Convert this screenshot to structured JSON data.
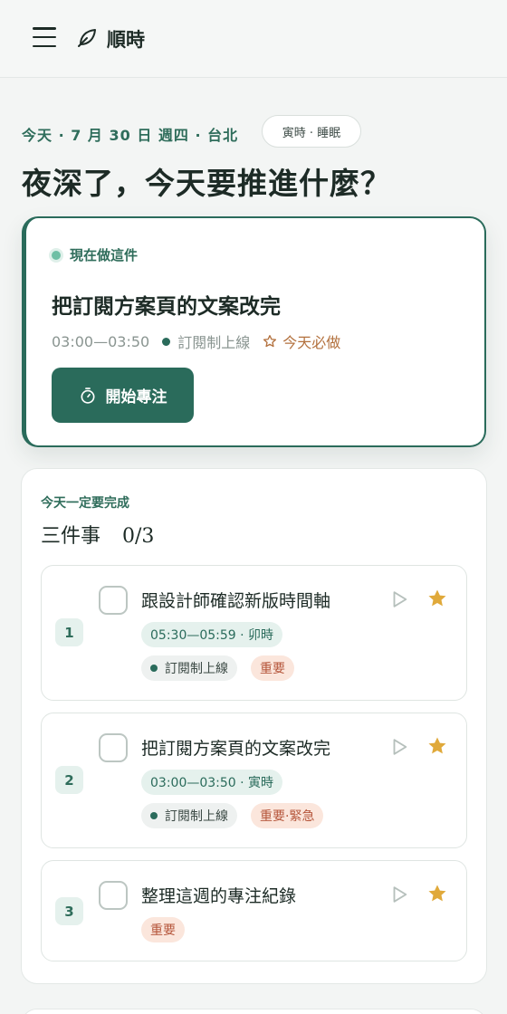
{
  "header": {
    "app_name": "順時",
    "menu_icon": "hamburger-icon",
    "logo_icon": "leaf-icon"
  },
  "date_line": "今天 · 7 月 30 日 週四 · 台北",
  "time_status": "寅時 · 睡眠",
  "greeting": "夜深了，今天要推進什麼？",
  "current_task": {
    "label": "現在做這件",
    "title": "把訂閱方案頁的文案改完",
    "time": "03:00—03:50",
    "project": "訂閱制上線",
    "priority": "今天必做",
    "start_button": "開始專注"
  },
  "must_do": {
    "kicker": "今天一定要完成",
    "heading": "三件事",
    "count": "0/3",
    "tasks": [
      {
        "number": "1",
        "title": "跟設計師確認新版時間軸",
        "time": "05:30—05:59 · 卯時",
        "project": "訂閱制上線",
        "tag": "重要"
      },
      {
        "number": "2",
        "title": "把訂閱方案頁的文案改完",
        "time": "03:00—03:50 · 寅時",
        "project": "訂閱制上線",
        "tag": "重要·緊急"
      },
      {
        "number": "3",
        "title": "整理這週的專注紀錄",
        "tag": "重要"
      }
    ]
  },
  "colors": {
    "accent": "#2a6b5b",
    "star": "#e0a93a",
    "tag_text": "#b5553a",
    "must_do_text": "#b3713e"
  }
}
